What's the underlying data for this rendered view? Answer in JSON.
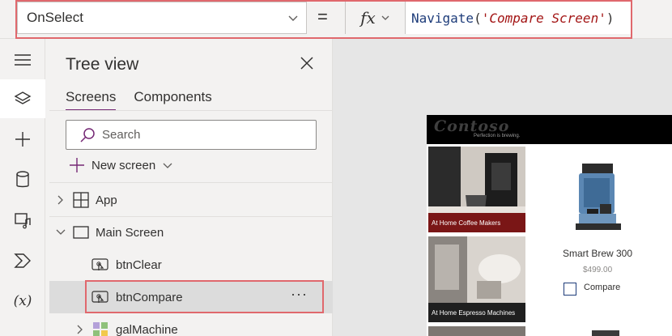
{
  "formula_bar": {
    "property": "OnSelect",
    "equals": "=",
    "fx": "fx",
    "formula_fn": "Navigate",
    "formula_open": "(",
    "formula_arg": "'Compare Screen'",
    "formula_close": ")"
  },
  "rail": {
    "items": [
      "hamburger-icon",
      "layers-icon",
      "plus-icon",
      "database-icon",
      "media-icon",
      "power-automate-icon",
      "variables-icon"
    ],
    "variables_label": "(x)"
  },
  "tree": {
    "title": "Tree view",
    "tabs": [
      "Screens",
      "Components"
    ],
    "active_tab": "Screens",
    "search_placeholder": "Search",
    "new_screen": "New screen",
    "nodes": [
      {
        "label": "App"
      },
      {
        "label": "Main Screen"
      },
      {
        "label": "btnClear"
      },
      {
        "label": "btnCompare"
      },
      {
        "label": "galMachine"
      }
    ],
    "more": "···"
  },
  "canvas": {
    "logo": "Contoso",
    "tagline": "Perfection is brewing.",
    "tiles": [
      "At Home Coffee Makers",
      "At Home Espresso Machines"
    ],
    "product_name": "Smart Brew 300",
    "product_price": "$499.00",
    "compare_label": "Compare"
  },
  "colors": {
    "accent": "#742774",
    "highlight_outline": "#e0686d",
    "selected_row": "#dcdcdc",
    "tile_caption_1": "#7a1616"
  }
}
